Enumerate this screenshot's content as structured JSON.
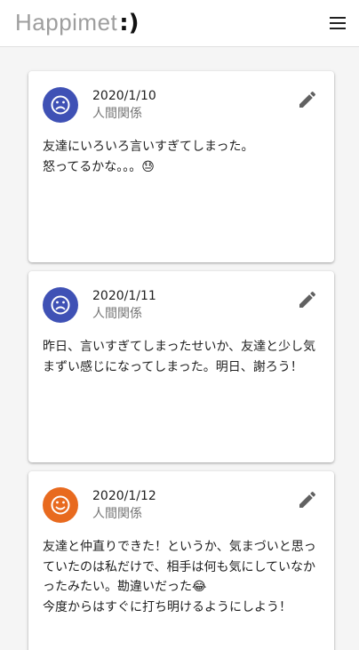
{
  "header": {
    "brand_text": "Happimet",
    "brand_emoticon": ":)",
    "menu_icon": "menu-icon"
  },
  "entries": [
    {
      "date": "2020/1/10",
      "category": "人間関係",
      "mood": "sad",
      "mood_color": "#3f51b5",
      "mood_icon": "sad-face-icon",
      "edit_icon": "pencil-icon",
      "text": "友達にいろいろ言いすぎてしまった。\n怒ってるかな。。。😓"
    },
    {
      "date": "2020/1/11",
      "category": "人間関係",
      "mood": "sad",
      "mood_color": "#3f51b5",
      "mood_icon": "sad-face-icon",
      "edit_icon": "pencil-icon",
      "text": "昨日、言いすぎてしまったせいか、友達と少し気まずい感じになってしまった。明日、謝ろう！"
    },
    {
      "date": "2020/1/12",
      "category": "人間関係",
      "mood": "happy",
      "mood_color": "#e86a1f",
      "mood_icon": "happy-face-icon",
      "edit_icon": "pencil-icon",
      "text": "友達と仲直りできた！というか、気まづいと思っていたのは私だけで、相手は何も気にしていなかったみたい。勘違いだった😂\n今度からはすぐに打ち明けるようにしよう！"
    }
  ]
}
